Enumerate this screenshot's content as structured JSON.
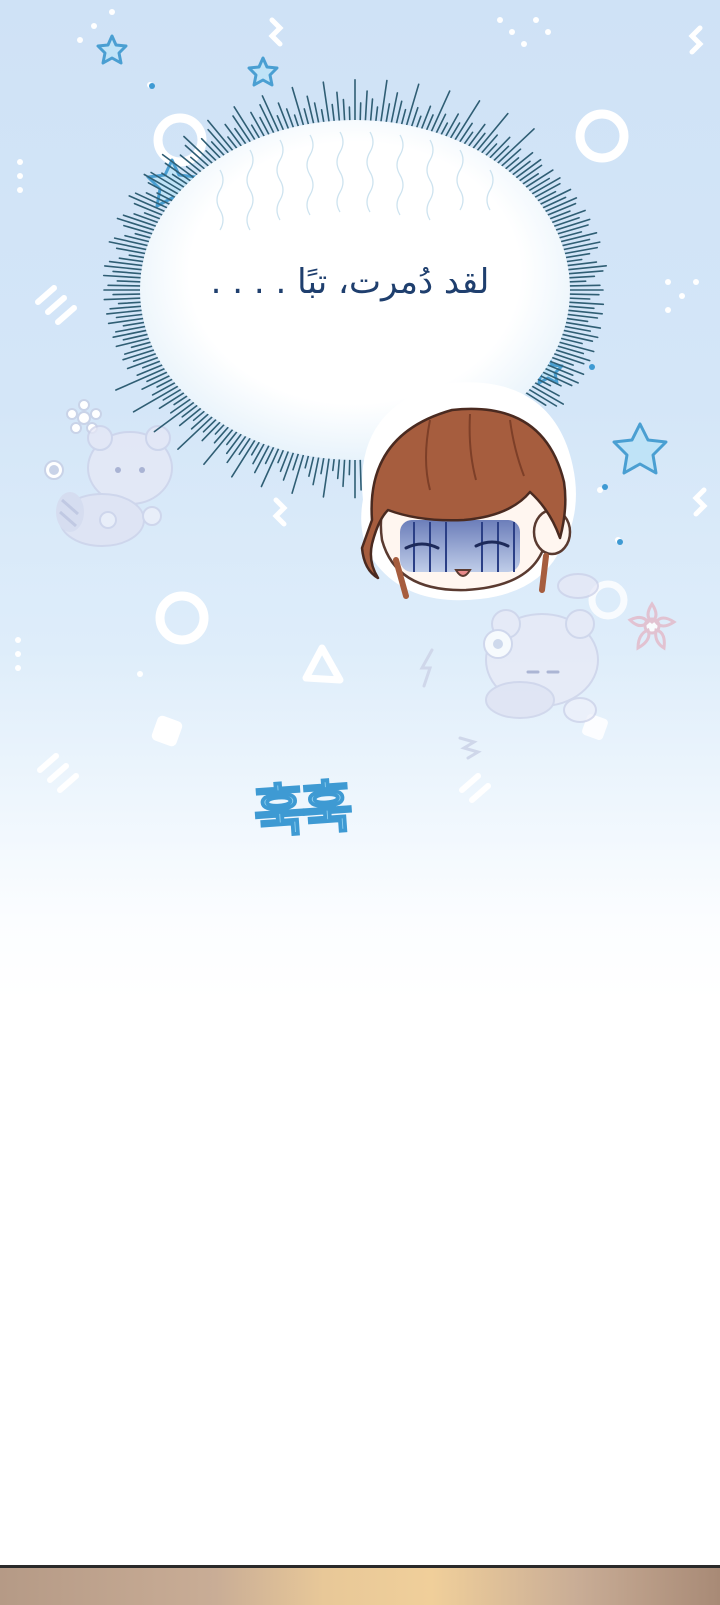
{
  "panel": {
    "speech": "لقد دُمرت، تبًا . . . .",
    "sound_effect": "훅훅"
  },
  "colors": {
    "sky_top": "#cfe2f6",
    "speech_text": "#1f3f6e",
    "sfx_fill": "#8fd0f0",
    "sfx_outline": "#3e9ad3",
    "hair": "#a65d3e"
  }
}
